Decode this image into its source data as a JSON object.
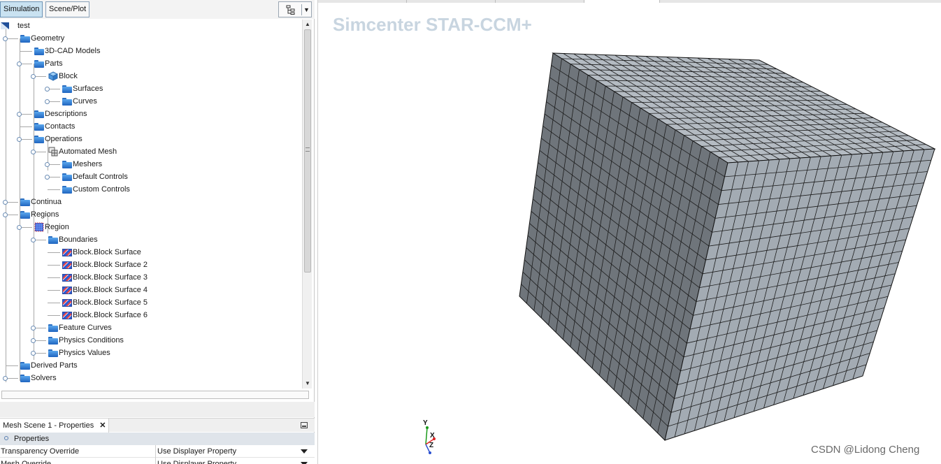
{
  "tabs": {
    "simulation": "Simulation",
    "scene_plot": "Scene/Plot"
  },
  "tree": {
    "items": [
      {
        "label": "test",
        "icon": "sim-icon"
      },
      {
        "label": "Geometry",
        "icon": "folder-icon"
      },
      {
        "label": "3D-CAD Models",
        "icon": "folder-icon"
      },
      {
        "label": "Parts",
        "icon": "folder-icon"
      },
      {
        "label": "Block",
        "icon": "cube-icon"
      },
      {
        "label": "Surfaces",
        "icon": "folder-icon"
      },
      {
        "label": "Curves",
        "icon": "folder-icon"
      },
      {
        "label": "Descriptions",
        "icon": "folder-icon"
      },
      {
        "label": "Contacts",
        "icon": "folder-icon"
      },
      {
        "label": "Operations",
        "icon": "folder-icon"
      },
      {
        "label": "Automated Mesh",
        "icon": "mesh-operation-icon"
      },
      {
        "label": "Meshers",
        "icon": "folder-icon"
      },
      {
        "label": "Default Controls",
        "icon": "folder-icon"
      },
      {
        "label": "Custom Controls",
        "icon": "folder-icon"
      },
      {
        "label": "Continua",
        "icon": "folder-icon"
      },
      {
        "label": "Regions",
        "icon": "folder-icon"
      },
      {
        "label": "Region",
        "icon": "region-icon"
      },
      {
        "label": "Boundaries",
        "icon": "folder-icon"
      },
      {
        "label": "Block.Block Surface",
        "icon": "boundary-icon"
      },
      {
        "label": "Block.Block Surface 2",
        "icon": "boundary-icon"
      },
      {
        "label": "Block.Block Surface 3",
        "icon": "boundary-icon"
      },
      {
        "label": "Block.Block Surface 4",
        "icon": "boundary-icon"
      },
      {
        "label": "Block.Block Surface 5",
        "icon": "boundary-icon"
      },
      {
        "label": "Block.Block Surface 6",
        "icon": "boundary-icon"
      },
      {
        "label": "Feature Curves",
        "icon": "folder-icon"
      },
      {
        "label": "Physics Conditions",
        "icon": "folder-icon"
      },
      {
        "label": "Physics Values",
        "icon": "folder-icon"
      },
      {
        "label": "Derived Parts",
        "icon": "folder-icon"
      },
      {
        "label": "Solvers",
        "icon": "folder-icon"
      }
    ]
  },
  "properties": {
    "tab_title": "Mesh Scene 1 - Properties",
    "close_glyph": "✕",
    "section": "Properties",
    "rows": [
      {
        "key": "Transparency Override",
        "value": "Use Displayer Property"
      },
      {
        "key": "Mesh Override",
        "value": "Use Displayer Property"
      }
    ]
  },
  "viewer": {
    "brand": "Simcenter STAR-CCM+",
    "watermark": "CSDN @Lidong Cheng",
    "axes": {
      "x": "X",
      "y": "Y",
      "z": "Z"
    },
    "mesh_color": "#9ea6ae",
    "grid_divisions": 20
  }
}
